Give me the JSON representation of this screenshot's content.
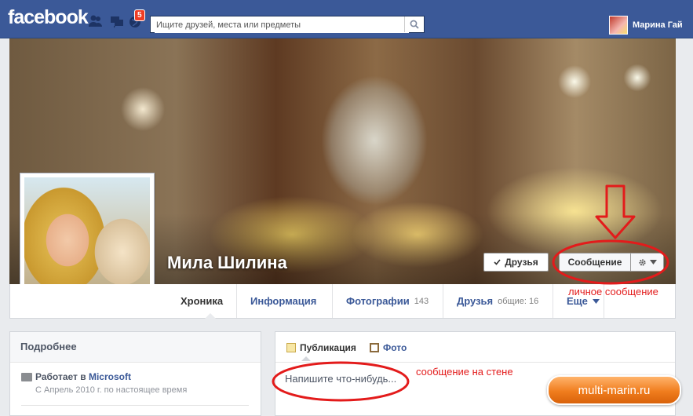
{
  "topbar": {
    "logo": "facebook",
    "notifications_badge": "5",
    "search_placeholder": "Ищите друзей, места или предметы",
    "user_name": "Марина Гай"
  },
  "profile": {
    "name": "Мила Шилина",
    "buttons": {
      "friends": "Друзья",
      "message": "Сообщение"
    }
  },
  "tabs": [
    {
      "label": "Хроника",
      "count": ""
    },
    {
      "label": "Информация",
      "count": ""
    },
    {
      "label": "Фотографии",
      "count": "143"
    },
    {
      "label": "Друзья",
      "count": "общие: 16"
    },
    {
      "label": "Еще",
      "count": ""
    }
  ],
  "about": {
    "title": "Подробнее",
    "work_prefix": "Работает в",
    "work_company": "Microsoft",
    "work_period": "С Апрель 2010 г. по настоящее время"
  },
  "composer": {
    "tab_post": "Публикация",
    "tab_photo": "Фото",
    "placeholder": "Напишите что-нибудь..."
  },
  "annotations": {
    "private_message": "личное сообщение",
    "wall_message": "сообщение на стене",
    "watermark": "multi-marin.ru"
  },
  "colors": {
    "brand": "#3b5998",
    "annotation": "#e31b1b",
    "watermark": "#f07d1e"
  }
}
